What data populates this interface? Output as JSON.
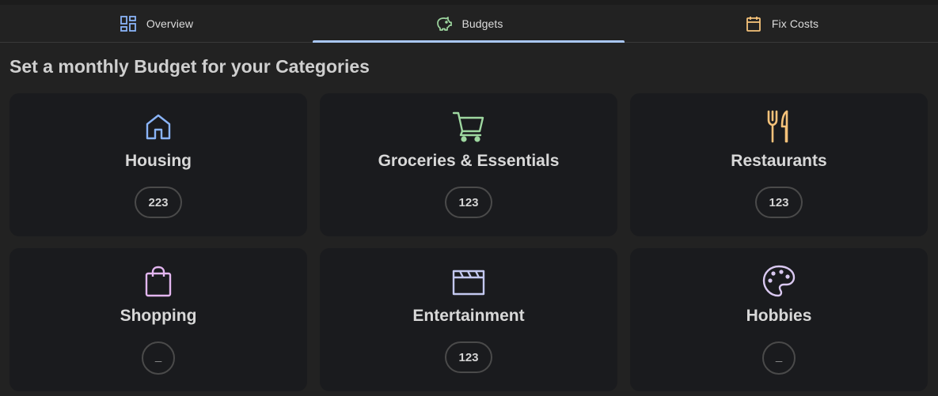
{
  "tabs": [
    {
      "label": "Overview",
      "icon": "dashboard-icon",
      "color": "#8ab4f8",
      "active": false
    },
    {
      "label": "Budgets",
      "icon": "piggy-bank-icon",
      "color": "#9ed7a0",
      "active": true
    },
    {
      "label": "Fix Costs",
      "icon": "calendar-icon",
      "color": "#f5c27a",
      "active": false
    }
  ],
  "page": {
    "heading": "Set a monthly Budget for your Categories"
  },
  "categories": [
    {
      "name": "Housing",
      "budget": "223",
      "icon": "house-icon",
      "color": "#8ab4f8"
    },
    {
      "name": "Groceries & Essentials",
      "budget": "123",
      "icon": "shopping-cart-icon",
      "color": "#9ed7a0"
    },
    {
      "name": "Restaurants",
      "budget": "123",
      "icon": "fork-knife-icon",
      "color": "#f5c27a"
    },
    {
      "name": "Shopping",
      "budget": "_",
      "icon": "shopping-bag-icon",
      "color": "#e3b6f0"
    },
    {
      "name": "Entertainment",
      "budget": "123",
      "icon": "clapperboard-icon",
      "color": "#c3c8f0"
    },
    {
      "name": "Hobbies",
      "budget": "_",
      "icon": "palette-icon",
      "color": "#d9c8f0"
    }
  ]
}
